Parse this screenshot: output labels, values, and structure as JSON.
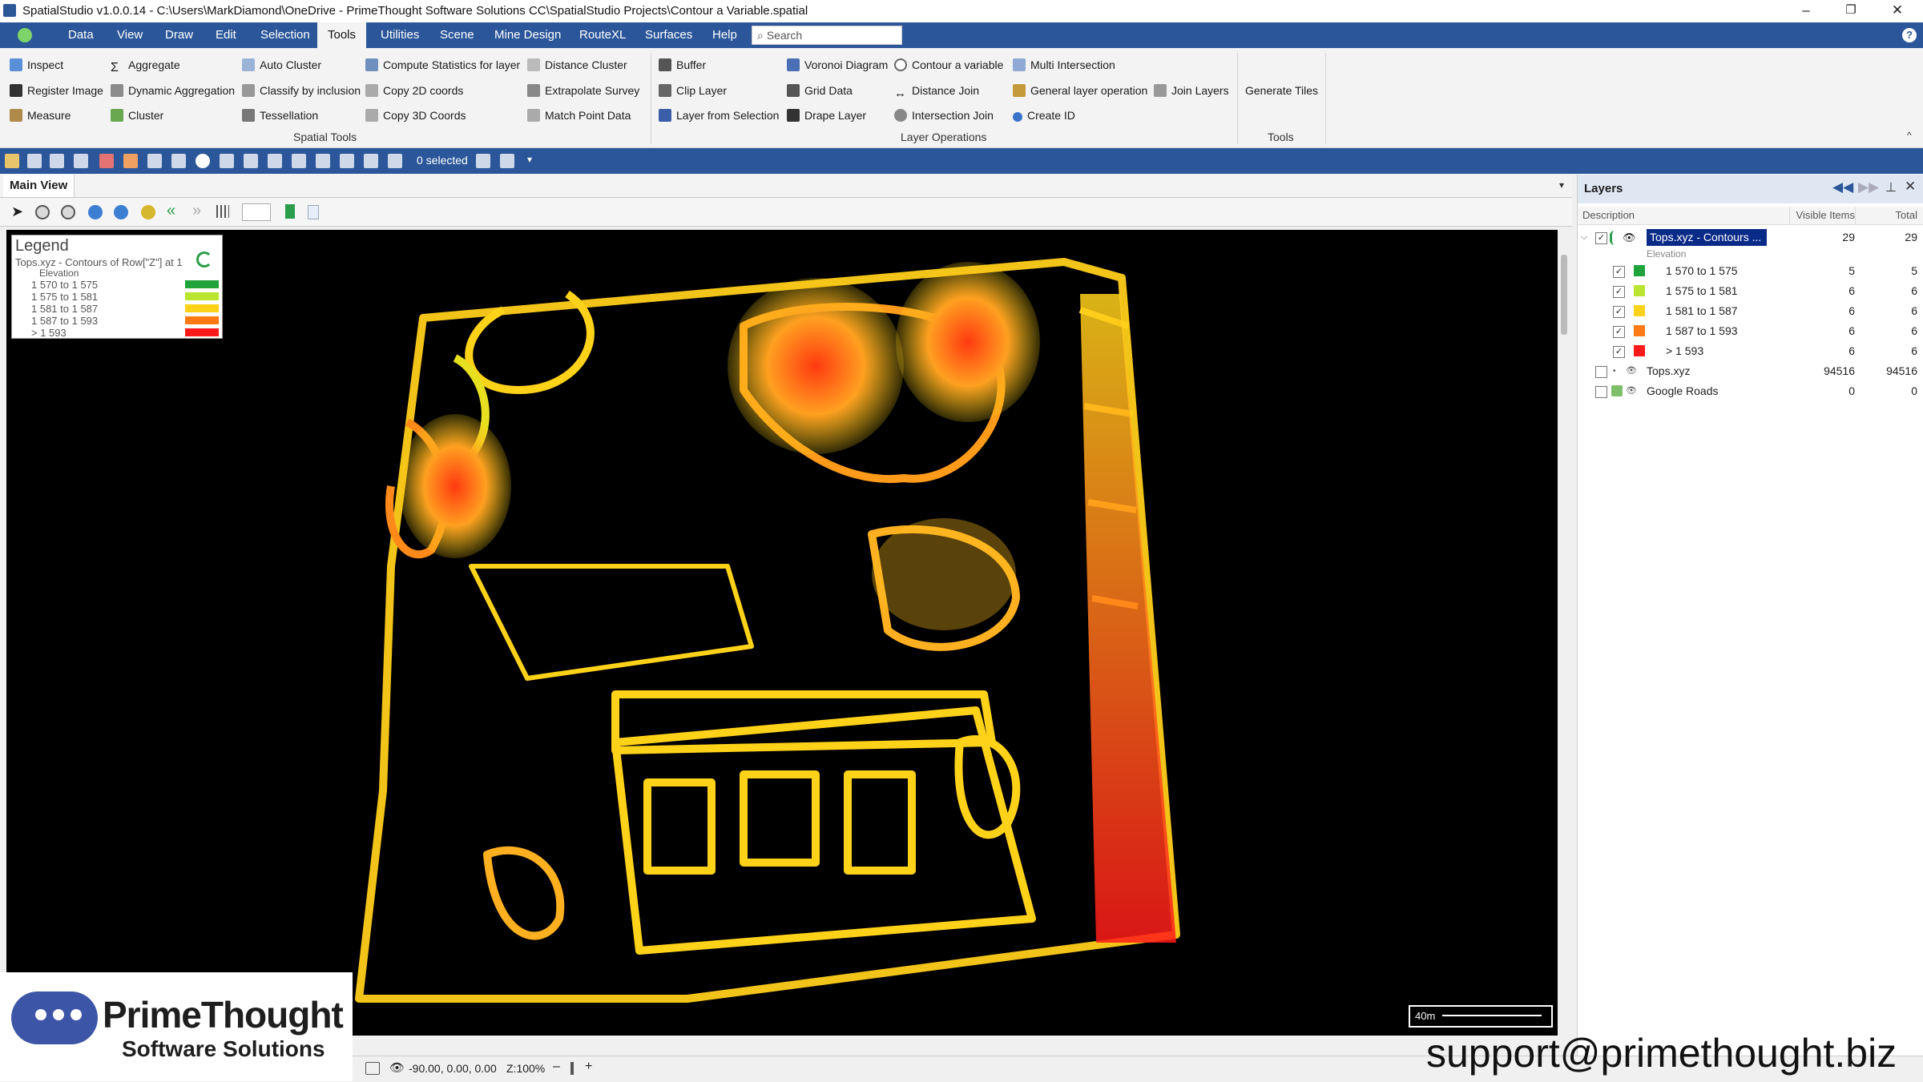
{
  "window": {
    "title": "SpatialStudio v1.0.0.14 - C:\\Users\\MarkDiamond\\OneDrive - PrimeThought Software Solutions CC\\SpatialStudio Projects\\Contour a Variable.spatial",
    "minimize": "–",
    "restore": "❐",
    "close": "✕"
  },
  "menu": {
    "items": [
      "Data",
      "View",
      "Draw",
      "Edit",
      "Selection",
      "Tools",
      "Utilities",
      "Scene",
      "Mine Design",
      "RouteXL",
      "Surfaces",
      "Help"
    ],
    "active": "Tools",
    "search_placeholder": "Search",
    "help_icon": "?"
  },
  "ribbon": {
    "spatial_tools": {
      "label": "Spatial Tools",
      "col1": [
        "Inspect",
        "Register Image",
        "Measure"
      ],
      "col2": [
        "Aggregate",
        "Dynamic Aggregation",
        "Cluster"
      ],
      "col3": [
        "Auto Cluster",
        "Classify by inclusion",
        "Tessellation"
      ],
      "col4": [
        "Compute Statistics for layer",
        "Copy 2D coords",
        "Copy 3D Coords"
      ],
      "col5": [
        "Distance Cluster",
        "Extrapolate Survey",
        "Match Point Data"
      ]
    },
    "layer_operations": {
      "label": "Layer Operations",
      "col1": [
        "Buffer",
        "Clip Layer",
        "Layer from Selection"
      ],
      "col2": [
        "Voronoi Diagram",
        "Grid Data",
        "Drape Layer"
      ],
      "col3": [
        "Contour a variable",
        "Distance Join",
        "Intersection Join"
      ],
      "col4": [
        "Multi Intersection",
        "General layer operation",
        "Create ID"
      ],
      "col5": [
        "Join Layers"
      ]
    },
    "tools": {
      "label": "Tools",
      "items": [
        "Generate Tiles"
      ]
    }
  },
  "toolbar": {
    "selected_count": "0 selected"
  },
  "main_view": {
    "tab": "Main View",
    "legend": {
      "title": "Legend",
      "layer": "Tops.xyz - Contours of Row[\"Z\"] at 1",
      "field": "Elevation",
      "entries": [
        {
          "label": "1 570 to 1 575",
          "color": "#1fa33a"
        },
        {
          "label": "1 575 to 1 581",
          "color": "#b9e52e"
        },
        {
          "label": "1 581 to 1 587",
          "color": "#ffd21a"
        },
        {
          "label": "1 587 to 1 593",
          "color": "#ff7a14"
        },
        {
          "label": "> 1 593",
          "color": "#ff1a1a"
        }
      ]
    },
    "scale_bar": "40m"
  },
  "layers_panel": {
    "title": "Layers",
    "columns": [
      "Description",
      "Visible Items",
      "Total"
    ],
    "layers": [
      {
        "name": "Tops.xyz - Contours ...",
        "visible": "29",
        "total": "29",
        "checked": true,
        "selected": true,
        "sublabel": "Elevation"
      },
      {
        "name": "1 570 to 1 575",
        "visible": "5",
        "total": "5",
        "checked": true,
        "color": "#1fa33a"
      },
      {
        "name": "1 575 to 1 581",
        "visible": "6",
        "total": "6",
        "checked": true,
        "color": "#b9e52e"
      },
      {
        "name": "1 581 to 1 587",
        "visible": "6",
        "total": "6",
        "checked": true,
        "color": "#ffd21a"
      },
      {
        "name": "1 587 to 1 593",
        "visible": "6",
        "total": "6",
        "checked": true,
        "color": "#ff7a14"
      },
      {
        "name": "> 1 593",
        "visible": "6",
        "total": "6",
        "checked": true,
        "color": "#ff1a1a"
      },
      {
        "name": "Tops.xyz",
        "visible": "94516",
        "total": "94516",
        "checked": false
      },
      {
        "name": "Google Roads",
        "visible": "0",
        "total": "0",
        "checked": false
      }
    ]
  },
  "status": {
    "coords": "-90.00, 0.00, 0.00",
    "zoom": "Z:100%"
  },
  "branding": {
    "name": "PrimeThought",
    "sub": "Software Solutions",
    "support": "support@primethought.biz"
  },
  "colors": {
    "accent": "#2b579a",
    "ribbon": "#f3f3f3",
    "selected_layer": "#0a2a88"
  }
}
